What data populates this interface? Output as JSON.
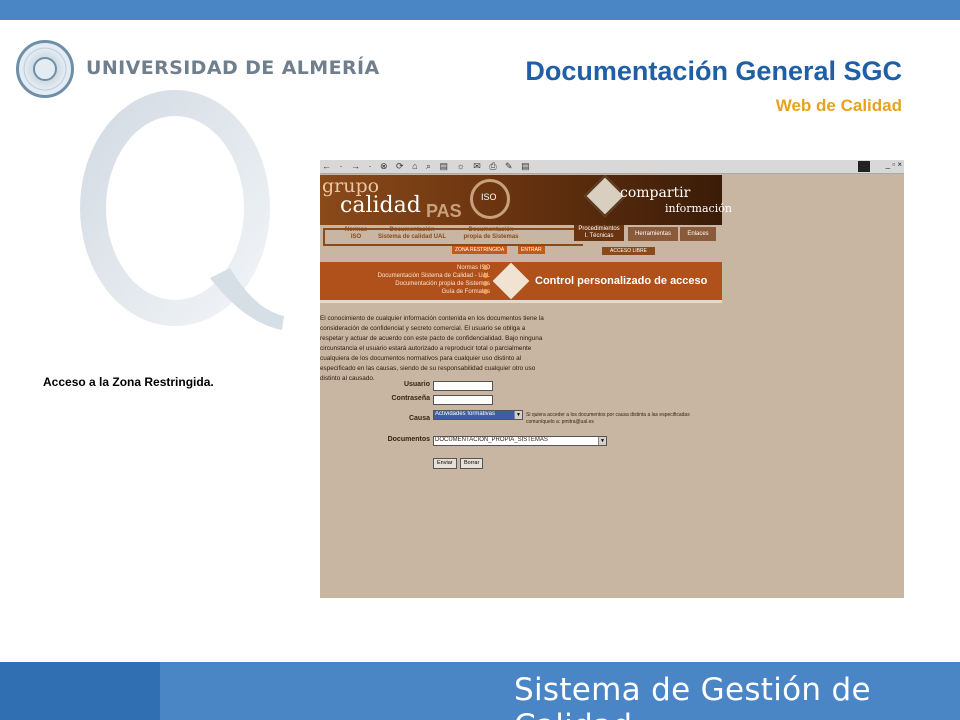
{
  "header": {
    "university": "UNIVERSIDAD DE ALMERÍA",
    "title": "Documentación General SGC",
    "subtitle": "Web de Calidad"
  },
  "caption": "Acceso a la Zona Restringida.",
  "footer": {
    "title": "Sistema de Gestión de Calidad"
  },
  "colors": {
    "blue_bar": "#4a86c6",
    "title_blue": "#1f5fa5",
    "subtitle_orange": "#e7a21f",
    "screenshot_bg": "#c8b6a2"
  },
  "screenshot": {
    "toolbar_icons": "← · → · ⊗ ⟳ ⌂ ⌕ ▤ ☼ ✉ ⎙ ✎ ▤",
    "window_controls": "_ ▫ ×",
    "banner": {
      "grupo": "grupo",
      "calidad": "calidad",
      "pas": "PAS",
      "iso": "ISO",
      "compartir": "compartir",
      "informacion": "información"
    },
    "nav": {
      "normas_l1": "Normas",
      "normas_l2": "ISO",
      "doc_ual_l1": "Documentación",
      "doc_ual_l2": "Sistema de calidad UAL",
      "doc_sis_l1": "Documentación",
      "doc_sis_l2": "propia de Sistemas",
      "procedimientos_l1": "Procedimientos",
      "procedimientos_l2": "I. Técnicas",
      "herramientas": "Herramientas",
      "enlaces": "Enlaces",
      "zona_restringida": "ZONA RESTRINGIDA",
      "entrar": "ENTRAR",
      "acceso_libre": "ACCESO LIBRE"
    },
    "menu": [
      "Normas ISO",
      "Documentación Sistema de Calidad - UAL",
      "Documentación propia de Sistemas",
      "Guía de Formatos"
    ],
    "ctrl_title": "Control personalizado de acceso",
    "disclaimer": [
      "El conocimiento de cualquier información contenida en los documentos tiene la",
      "consideración de confidencial y secreto comercial. El usuario se obliga a",
      "respetar y actuar de acuerdo con este pacto de confidencialidad. Bajo ninguna",
      "circunstancia el usuario estará autorizado a reproducir total o parcialmente",
      "cualquiera de los documentos normativos para cualquier uso distinto al",
      "especificado en las causas, siendo de su responsabilidad cualquier otro uso",
      "distinto al causado."
    ],
    "form": {
      "usuario_label": "Usuario",
      "usuario_value": "",
      "contrasena_label": "Contraseña",
      "contrasena_value": "",
      "causa_label": "Causa",
      "causa_selected": "Actividades formativas",
      "causa_hint": "Si quiera acceder a los documentos por causa distinta a las especificadas comuníquelo a: pmitra@ual.es",
      "documentos_label": "Documentos",
      "documentos_selected": "DOCUMENTACIÓN_PROPIA_SISTEMAS",
      "enviar": "Enviar",
      "borrar": "Borrar"
    }
  }
}
